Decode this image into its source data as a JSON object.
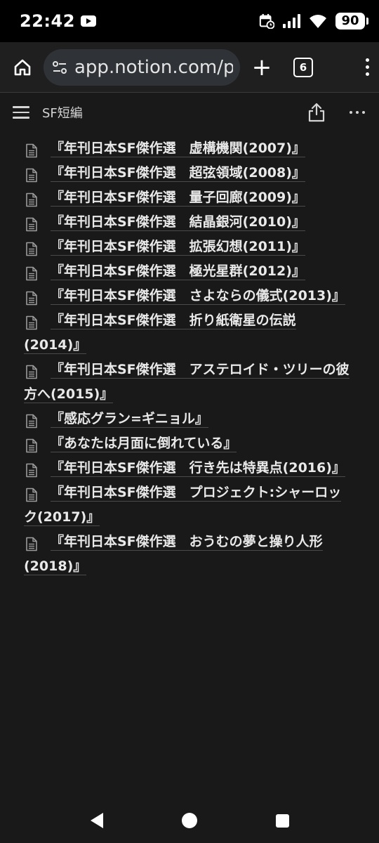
{
  "status": {
    "time": "22:42",
    "battery": "90"
  },
  "browser": {
    "url": "app.notion.com/p/S",
    "tab_count": "6"
  },
  "notion": {
    "page_title": "SF短編"
  },
  "pages": [
    {
      "title": "『年刊日本SF傑作選　虚構機関(2007)』"
    },
    {
      "title": "『年刊日本SF傑作選　超弦領域(2008)』"
    },
    {
      "title": "『年刊日本SF傑作選　量子回廊(2009)』"
    },
    {
      "title": "『年刊日本SF傑作選　結晶銀河(2010)』"
    },
    {
      "title": "『年刊日本SF傑作選　拡張幻想(2011)』"
    },
    {
      "title": "『年刊日本SF傑作選　極光星群(2012)』"
    },
    {
      "title": "『年刊日本SF傑作選　さよならの儀式(2013)』"
    },
    {
      "title": "『年刊日本SF傑作選　折り紙衛星の伝説(2014)』"
    },
    {
      "title": "『年刊日本SF傑作選　アステロイド・ツリーの彼方へ(2015)』"
    },
    {
      "title": "『感応グラン=ギニョル』"
    },
    {
      "title": "『あなたは月面に倒れている』"
    },
    {
      "title": "『年刊日本SF傑作選　行き先は特異点(2016)』"
    },
    {
      "title": "『年刊日本SF傑作選　プロジェクト:シャーロック(2017)』"
    },
    {
      "title": "『年刊日本SF傑作選　おうむの夢と操り人形(2018)』"
    }
  ]
}
